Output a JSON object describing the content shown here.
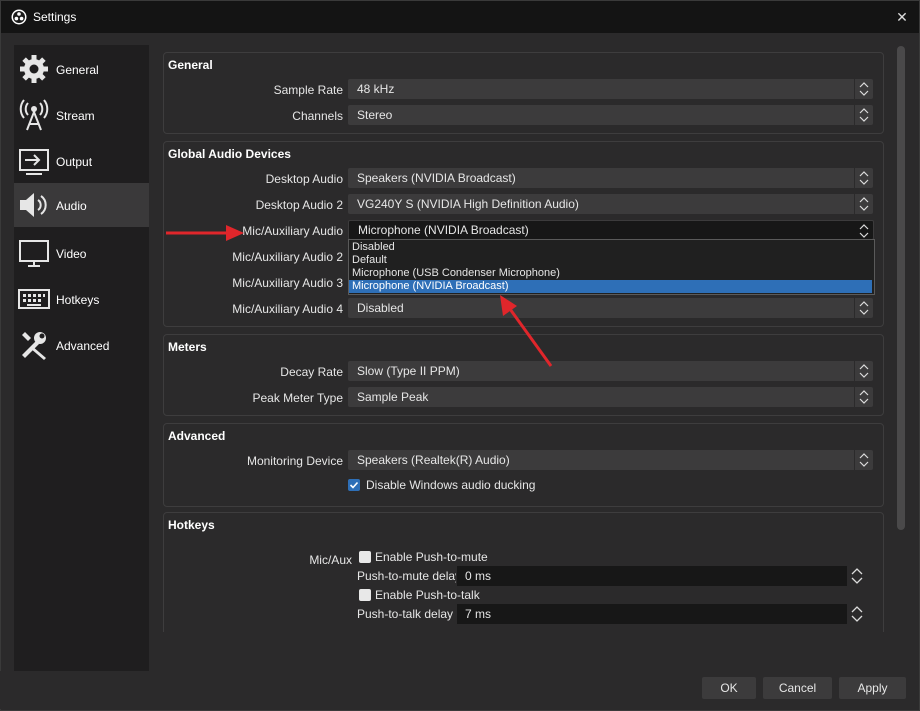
{
  "window": {
    "title": "Settings",
    "close_glyph": "✕"
  },
  "sidebar": {
    "items": [
      {
        "label": "General",
        "icon": "gear-icon"
      },
      {
        "label": "Stream",
        "icon": "broadcast-icon"
      },
      {
        "label": "Output",
        "icon": "output-icon"
      },
      {
        "label": "Audio",
        "icon": "speaker-icon",
        "active": true
      },
      {
        "label": "Video",
        "icon": "monitor-icon"
      },
      {
        "label": "Hotkeys",
        "icon": "keyboard-icon"
      },
      {
        "label": "Advanced",
        "icon": "tools-icon"
      }
    ]
  },
  "general": {
    "title": "General",
    "sample_rate_label": "Sample Rate",
    "sample_rate_value": "48 kHz",
    "channels_label": "Channels",
    "channels_value": "Stereo"
  },
  "global_audio": {
    "title": "Global Audio Devices",
    "desktop_audio_label": "Desktop Audio",
    "desktop_audio_value": "Speakers (NVIDIA Broadcast)",
    "desktop_audio2_label": "Desktop Audio 2",
    "desktop_audio2_value": "VG240Y S (NVIDIA High Definition Audio)",
    "mic_label": "Mic/Auxiliary Audio",
    "mic_value": "Microphone (NVIDIA Broadcast)",
    "mic2_label": "Mic/Auxiliary Audio 2",
    "mic3_label": "Mic/Auxiliary Audio 3",
    "mic4_label": "Mic/Auxiliary Audio 4",
    "mic4_value": "Disabled",
    "dropdown_options": [
      "Disabled",
      "Default",
      "Microphone (USB Condenser Microphone)",
      "Microphone (NVIDIA Broadcast)"
    ],
    "dropdown_selected_index": 3
  },
  "meters": {
    "title": "Meters",
    "decay_label": "Decay Rate",
    "decay_value": "Slow (Type II PPM)",
    "peak_label": "Peak Meter Type",
    "peak_value": "Sample Peak"
  },
  "advanced": {
    "title": "Advanced",
    "monitoring_label": "Monitoring Device",
    "monitoring_value": "Speakers (Realtek(R) Audio)",
    "ducking_label": "Disable Windows audio ducking",
    "ducking_checked": true
  },
  "hotkeys": {
    "title": "Hotkeys",
    "source_label": "Mic/Aux",
    "ptm_label": "Enable Push-to-mute",
    "ptm_checked": false,
    "ptm_delay_label": "Push-to-mute delay",
    "ptm_delay_value": "0 ms",
    "ptt_label": "Enable Push-to-talk",
    "ptt_checked": false,
    "ptt_delay_label": "Push-to-talk delay",
    "ptt_delay_value": "7 ms"
  },
  "buttons": {
    "ok": "OK",
    "cancel": "Cancel",
    "apply": "Apply"
  },
  "colors": {
    "accent": "#2e6fb7",
    "annotation_arrow": "#e0262b"
  }
}
